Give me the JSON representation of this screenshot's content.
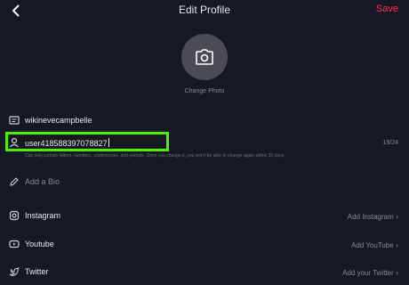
{
  "header": {
    "title": "Edit Profile",
    "save_label": "Save"
  },
  "avatar": {
    "change_label": "Change Photo"
  },
  "fields": {
    "name_value": "wikinevecampbelle",
    "username_value": "user418588397078827",
    "username_counter": "19/24",
    "username_hint": "Can only contain letters, numbers, underscores, and periods. Once you change it, you won't be able to change again within 30 days.",
    "bio_placeholder": "Add a Bio"
  },
  "social": {
    "instagram_label": "Instagram",
    "instagram_action": "Add Instagram",
    "youtube_label": "Youtube",
    "youtube_action": "Add YouTube",
    "twitter_label": "Twitter",
    "twitter_action": "Add your Twitter"
  },
  "colors": {
    "background": "#161823",
    "accent": "#fe2c55",
    "highlight": "#4cf000"
  }
}
